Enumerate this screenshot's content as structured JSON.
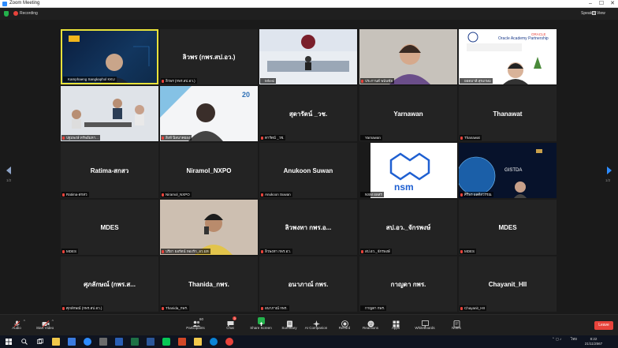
{
  "window": {
    "title": "Zoom Meeting"
  },
  "infobar": {
    "recording_label": "Recording",
    "speaker_label": "Speaker",
    "view_label": "View"
  },
  "pagination": {
    "left_page": "1/2",
    "right_page": "1/2"
  },
  "tiles": [
    {
      "name": "KKU",
      "label": "Kamphaeng Sangkaphol KKU",
      "display": "",
      "kind": "kku",
      "mic_muted": false,
      "active": true
    },
    {
      "name": "ลิวพร",
      "label": "ลิวพร (กพร.สป.อว.)",
      "display": "ลิวพร (กพร.สป.อว.)",
      "kind": "name",
      "mic_muted": true
    },
    {
      "name": "room",
      "label": "Mhesi",
      "display": "",
      "kind": "room",
      "mic_muted": false
    },
    {
      "name": "woman-1",
      "label": "ประกานต์ พนันชัย",
      "display": "",
      "kind": "woman1",
      "mic_muted": true
    },
    {
      "name": "oracle",
      "label": "ยอดมาลี สุขเกษม",
      "display": "",
      "kind": "oracle",
      "slide_title": "Oracle Academy Partnership",
      "brand": "ORACLE",
      "mic_muted": false
    },
    {
      "name": "office",
      "label": "ปฐมพงษ์ ทรัพย์มหา...",
      "display": "",
      "kind": "office",
      "mic_muted": true
    },
    {
      "name": "20th",
      "label": "สิงห์ นิลนาคยอง",
      "display": "",
      "kind": "twenty",
      "badge": "20",
      "mic_muted": true
    },
    {
      "name": "สุดารัตน์",
      "label": "ดารัตน์ _วช.",
      "display": "สุดารัตน์ _วช.",
      "kind": "name",
      "mic_muted": true
    },
    {
      "name": "Yarnawan",
      "label": "Yarnawan",
      "display": "Yarnawan",
      "kind": "name",
      "mic_muted": false
    },
    {
      "name": "Thanawat",
      "label": "Thanawat",
      "display": "Thanawat",
      "kind": "name",
      "mic_muted": true
    },
    {
      "name": "Ratima",
      "label": "Ratima-สกสว",
      "display": "Ratima-สกสว",
      "kind": "name",
      "mic_muted": true
    },
    {
      "name": "Niramol",
      "label": "Niramol_NXPO",
      "display": "Niramol_NXPO",
      "kind": "name",
      "mic_muted": true
    },
    {
      "name": "Anukoon",
      "label": "Anukoon Suwan",
      "display": "Anukoon Suwan",
      "kind": "name",
      "mic_muted": true
    },
    {
      "name": "nsm",
      "label": "NSM ผลสร",
      "display": "",
      "kind": "nsm",
      "logo_text": "nsm",
      "mic_muted": false
    },
    {
      "name": "gistda",
      "label": "ศิริพร ผลดีสวรรณ",
      "display": "",
      "kind": "gistda",
      "logo_text": "GISTDA",
      "mic_muted": true
    },
    {
      "name": "MDES-1",
      "label": "MDES",
      "display": "MDES",
      "kind": "name",
      "mic_muted": true
    },
    {
      "name": "woman-2",
      "label": "ปรียา ยอรัตน์ ทองรัก_อว.มท",
      "display": "",
      "kind": "woman2",
      "mic_muted": true
    },
    {
      "name": "ลิวพงทา",
      "label": "ลิวพงทา กพร.อว.",
      "display": "ลิวพงทา กพร.อ...",
      "kind": "name",
      "mic_muted": true
    },
    {
      "name": "สป.อว.",
      "label": "สป.อว._จักรพงษ์",
      "display": "สป.อว._จักรพงษ์",
      "kind": "name",
      "mic_muted": true
    },
    {
      "name": "MDES-2",
      "label": "MDES",
      "display": "MDES",
      "kind": "name",
      "mic_muted": true
    },
    {
      "name": "ศุภลักษณ์",
      "label": "ศุภลักษณ์ (กพร.สป.อว.)",
      "display": "ศุภลักษณ์ (กพร.ส...",
      "kind": "name",
      "mic_muted": true
    },
    {
      "name": "Thanida",
      "label": "Thanida_กพร.",
      "display": "Thanida_กพร.",
      "kind": "name",
      "mic_muted": true
    },
    {
      "name": "อนาภาณ์",
      "label": "อนาภาณ์ กพร.",
      "display": "อนาภาณ์ กพร.",
      "kind": "name",
      "mic_muted": true
    },
    {
      "name": "กาญดา",
      "label": "กาญดา กพร.",
      "display": "กาญดา กพร.",
      "kind": "name",
      "mic_muted": false
    },
    {
      "name": "Chayanit",
      "label": "Chayanit_HII",
      "display": "Chayanit_HII",
      "kind": "name",
      "mic_muted": true
    }
  ],
  "toolbar": {
    "audio": "Audio",
    "video": "Start Video",
    "participants": "Participants",
    "participants_count": "60",
    "chat": "Chat",
    "chat_badge": "3",
    "share": "Share Screen",
    "summary": "Summary",
    "companion": "AI Companion",
    "record": "Record",
    "reactions": "Reactions",
    "apps": "Apps",
    "whiteboards": "Whiteboards",
    "notes": "Notes",
    "end": "Leave"
  },
  "taskbar": {
    "lang": "ไทย",
    "time": "8:22",
    "date": "21/11/2567"
  },
  "colors": {
    "accent": "#2d8cff",
    "end_red": "#e8433b",
    "active_border": "#e8e23a",
    "tile_bg": "#232323"
  }
}
